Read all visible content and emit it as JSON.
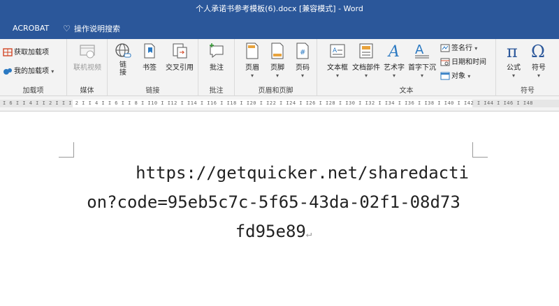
{
  "window": {
    "title": "个人承诺书参考模板(6).docx [兼容模式]  -  Word"
  },
  "menubar": {
    "acrobat": "ACROBAT",
    "tell_me": "操作说明搜索"
  },
  "ribbon": {
    "addins": {
      "get": "获取加载项",
      "mine": "我的加载项",
      "label": "加载项"
    },
    "media": {
      "video": "联机视频",
      "label": "媒体"
    },
    "links": {
      "link": "链\n接",
      "bookmark": "书签",
      "crossref": "交叉引用",
      "label": "链接"
    },
    "comments": {
      "comment": "批注",
      "label": "批注"
    },
    "headerfooter": {
      "header": "页眉",
      "footer": "页脚",
      "pagenum": "页码",
      "label": "页眉和页脚"
    },
    "text": {
      "textbox": "文本框",
      "quickparts": "文档部件",
      "wordart": "艺术字",
      "dropcap": "首字下沉",
      "signature": "签名行",
      "datetime": "日期和时间",
      "object": "对象",
      "label": "文本"
    },
    "symbols": {
      "equation": "公式",
      "symbol": "符号",
      "label": "符号"
    }
  },
  "ruler": {
    "ticks": "I 6 I  I 4 I  I 2 I  I        I 2 I  I 4 I  I 6 I  I 8 I  I10 I  I12 I  I14 I  I16 I  I18 I  I20 I  I22 I  I24 I  I26 I  I28 I  I30 I  I32 I  I34 I  I36 I  I38 I  I40 I  I42 I  I44 I  I46 I  I48"
  },
  "document": {
    "line1": "https://getquicker.net/sharedacti",
    "line2": "on?code=95eb5c7c-5f65-43da-02f1-08d73",
    "line3": "fd95e89",
    "paragraph_mark": "↵"
  }
}
